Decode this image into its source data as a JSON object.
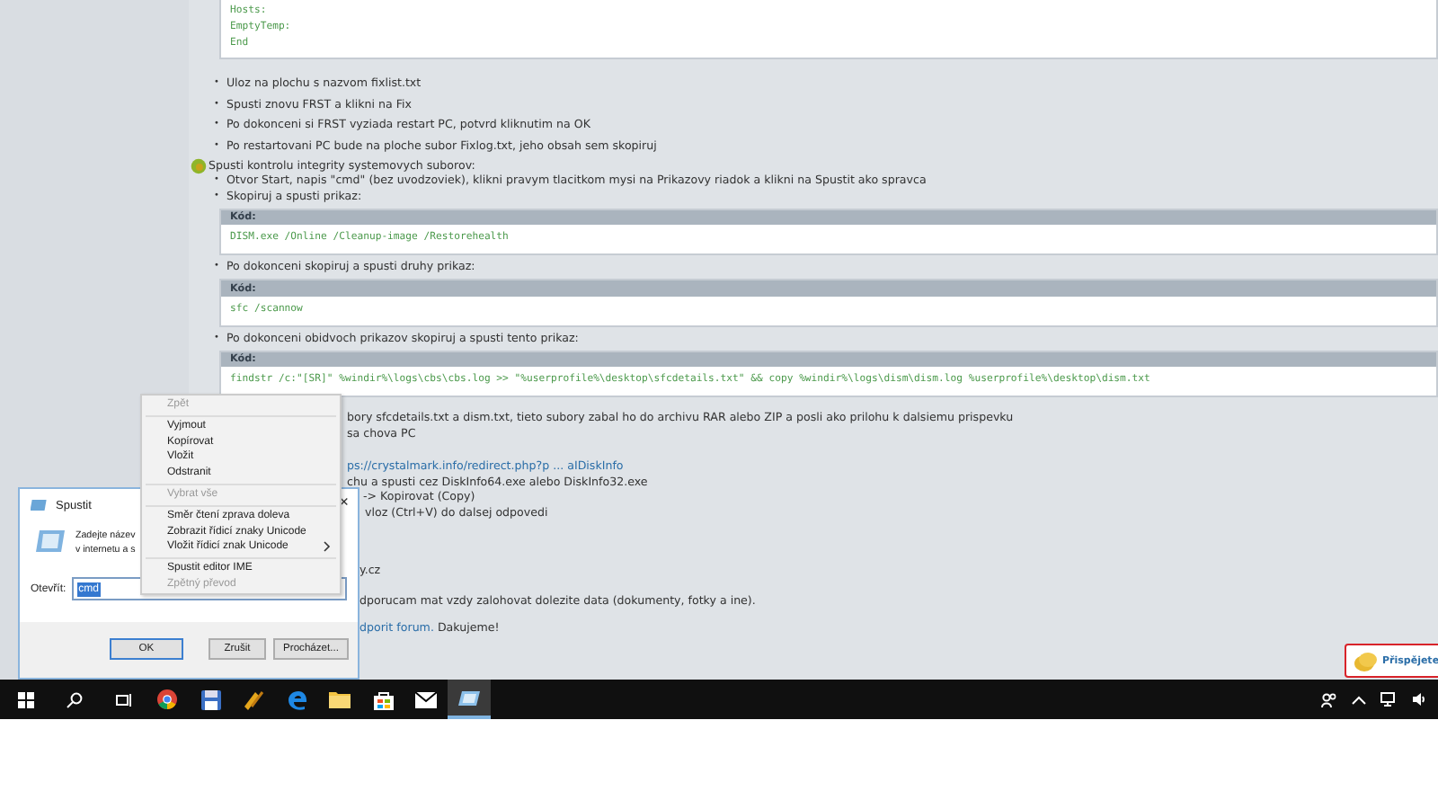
{
  "post": [
    {
      "kind": "code",
      "lines": [
        "Hosts:",
        "EmptyTemp:",
        "End"
      ]
    },
    {
      "kind": "bullets",
      "marker": "•",
      "items": [
        "Uloz na plochu s nazvom fixlist.txt",
        "Spusti znovu FRST a klikni na Fix",
        "Po dokonceni si FRST vyziada restart PC, potvrd kliknutim na OK",
        "Po restartovani PC bude na ploche subor Fixlog.txt, jeho obsah sem skopiruj"
      ]
    },
    {
      "kind": "heading",
      "text": "Spusti kontrolu integrity systemovych suborov:"
    },
    {
      "kind": "bullets",
      "marker": "•",
      "items": [
        "Otvor Start, napis \"cmd\" (bez uvodzoviek), klikni pravym tlacitkom mysi na Prikazovy riadok a klikni na Spustit ako spravca",
        "Skopiruj a spusti prikaz:"
      ]
    },
    {
      "kind": "code",
      "header": "Kód:",
      "lines": [
        "DISM.exe /Online /Cleanup-image /Restorehealth"
      ]
    },
    {
      "kind": "bullets",
      "marker": "•",
      "items": [
        "Po dokonceni skopiruj a spusti druhy prikaz:"
      ]
    },
    {
      "kind": "code",
      "header": "Kód:",
      "lines": [
        "sfc /scannow"
      ]
    },
    {
      "kind": "bullets",
      "marker": "•",
      "items": [
        "Po dokonceni obidvoch prikazov skopiruj a spusti tento prikaz:"
      ]
    },
    {
      "kind": "code",
      "header": "Kód:",
      "lines": [
        "findstr /c:\"[SR]\" %windir%\\logs\\cbs\\cbs.log >> \"%userprofile%\\desktop\\sfcdetails.txt\" && copy %windir%\\logs\\dism\\dism.log %userprofile%\\desktop\\dism.txt"
      ]
    }
  ],
  "fragments": [
    {
      "kind": "text",
      "text": "bory sfcdetails.txt a dism.txt, tieto subory zabal ho do archivu RAR alebo ZIP a posli ako prilohu k dalsiemu prispevku"
    },
    {
      "kind": "text",
      "text": "sa chova PC"
    },
    {
      "kind": "link",
      "text": "ps://crystalmark.info/redirect.php?p ... aIDiskInfo"
    },
    {
      "kind": "text",
      "text": "chu a spusti cez DiskInfo64.exe alebo DiskInfo32.exe"
    },
    {
      "kind": "text",
      "text": "-> Kopirovat (Copy)"
    },
    {
      "kind": "text",
      "text": "vloz (Ctrl+V) do dalsej odpovedi"
    },
    {
      "kind": "text",
      "text": "y.cz"
    },
    {
      "kind": "text",
      "text": "dporucam mat vzdy zalohovat dolezite data (dokumenty, fotky a ine)."
    },
    {
      "kind": "mixed",
      "link": "dporit forum.",
      "text": "Dakujeme!"
    }
  ],
  "donate": {
    "text": "Přispějete"
  },
  "context_menu": [
    {
      "label": "Zpět",
      "disabled": true
    },
    {
      "kind": "sep"
    },
    {
      "label": "Vyjmout",
      "disabled": false
    },
    {
      "label": "Kopírovat",
      "disabled": false
    },
    {
      "label": "Vložit",
      "disabled": false
    },
    {
      "label": "Odstranit",
      "disabled": false
    },
    {
      "kind": "sep"
    },
    {
      "label": "Vybrat vše",
      "disabled": true
    },
    {
      "kind": "sep"
    },
    {
      "label": "Směr čtení zprava doleva",
      "disabled": false
    },
    {
      "label": "Zobrazit řídicí znaky Unicode",
      "disabled": false
    },
    {
      "label": "Vložit řídicí znak Unicode",
      "disabled": false,
      "submenu": true
    },
    {
      "kind": "sep"
    },
    {
      "label": "Spustit editor IME",
      "disabled": false
    },
    {
      "label": "Zpětný převod",
      "disabled": true
    }
  ],
  "run_dialog": {
    "title": "Spustit",
    "close": "×",
    "description": [
      "Zadejte název",
      "v internetu a s"
    ],
    "open_label": "Otevřít:",
    "value": "cmd",
    "buttons": [
      "OK",
      "Zrušit",
      "Procházet..."
    ]
  },
  "taskbar": {
    "apps": [
      {
        "kind": "chrome",
        "selected": false
      },
      {
        "kind": "floppy",
        "selected": false
      },
      {
        "kind": "bolt",
        "selected": false
      },
      {
        "kind": "edge",
        "selected": false
      },
      {
        "kind": "folder",
        "selected": false
      },
      {
        "kind": "store",
        "selected": false
      },
      {
        "kind": "mail",
        "selected": false
      },
      {
        "kind": "run",
        "selected": true
      }
    ]
  }
}
